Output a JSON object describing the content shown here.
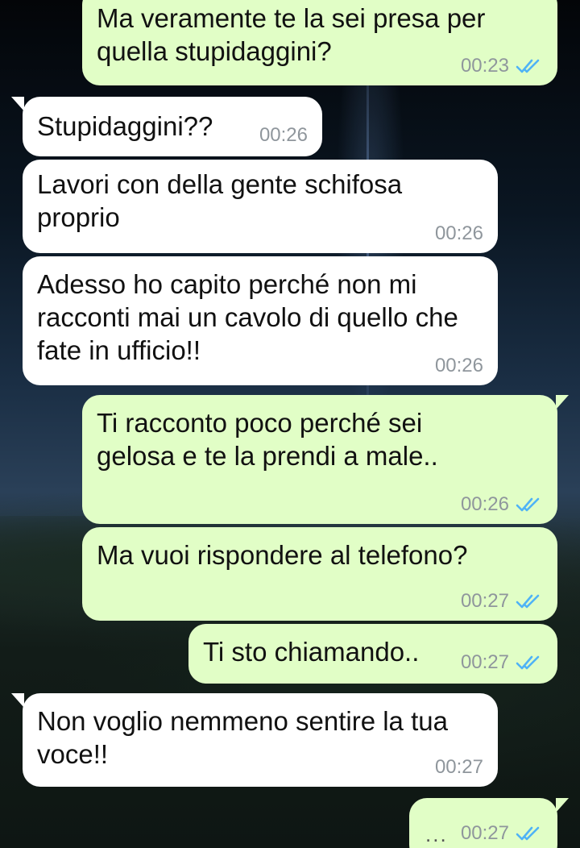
{
  "chat": {
    "messages": [
      {
        "direction": "out",
        "text": "Ma veramente te la sei presa per quella stupidaggini?",
        "time": "00:23",
        "status": "read-double-tick"
      },
      {
        "direction": "in",
        "text": "Stupidaggini??",
        "time": "00:26"
      },
      {
        "direction": "in",
        "text": "Lavori con della gente schifosa proprio",
        "time": "00:26"
      },
      {
        "direction": "in",
        "text": "Adesso ho capito perché non mi racconti mai un cavolo di quello che fate in ufficio!!",
        "time": "00:26"
      },
      {
        "direction": "out",
        "text": "Ti racconto poco perché sei gelosa e te la prendi a male..",
        "time": "00:26",
        "status": "read-double-tick"
      },
      {
        "direction": "out",
        "text": "Ma vuoi rispondere al telefono?",
        "time": "00:27",
        "status": "read-double-tick"
      },
      {
        "direction": "out",
        "text": "Ti sto chiamando..",
        "time": "00:27",
        "status": "read-double-tick"
      },
      {
        "direction": "in",
        "text": "Non voglio nemmeno sentire la tua voce!!",
        "time": "00:27"
      },
      {
        "direction": "out",
        "text": "...",
        "time": "00:27",
        "status": "read-double-tick"
      }
    ]
  },
  "icons": {
    "read_status": "double-check-icon"
  },
  "colors": {
    "outgoing_bubble": "#e1fec6",
    "incoming_bubble": "#ffffff",
    "read_tick": "#4fb3f6",
    "timestamp": "#8f969c"
  }
}
